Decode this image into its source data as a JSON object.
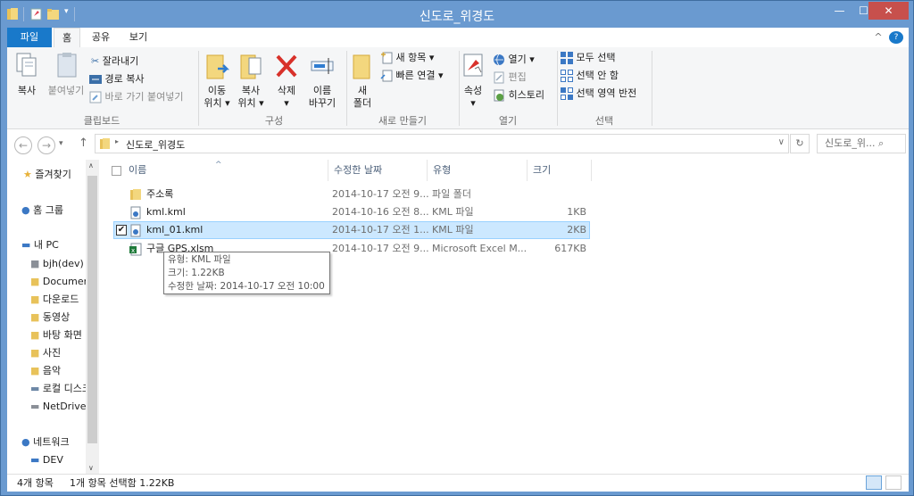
{
  "window": {
    "title": "신도로_위경도"
  },
  "window_buttons": {
    "minimize": "—",
    "maximize": "☐",
    "close": "✕"
  },
  "menu": {
    "file": "파일",
    "home": "홈",
    "share": "공유",
    "view": "보기",
    "expand": "^",
    "help": "?"
  },
  "ribbon": {
    "clipboard": {
      "copy": "복사",
      "paste": "붙여넣기",
      "cut": "잘라내기",
      "copy_path": "경로 복사",
      "paste_shortcut": "바로 가기 붙여넣기",
      "label": "클립보드"
    },
    "organize": {
      "move_line1": "이동",
      "move_line2": "위치 ▾",
      "copy_line1": "복사",
      "copy_line2": "위치 ▾",
      "delete": "삭제",
      "delete_arrow": "▾",
      "rename_line1": "이름",
      "rename_line2": "바꾸기",
      "label": "구성"
    },
    "new": {
      "folder_line1": "새",
      "folder_line2": "폴더",
      "new_item": "새 항목 ▾",
      "easy_access": "빠른 연결 ▾",
      "label": "새로 만들기"
    },
    "open": {
      "properties": "속성",
      "properties_arrow": "▾",
      "open": "열기 ▾",
      "edit": "편집",
      "history": "히스토리",
      "label": "열기"
    },
    "select": {
      "select_all": "모두 선택",
      "select_none": "선택 안 함",
      "invert": "선택 영역 반전",
      "label": "선택"
    }
  },
  "address": {
    "path": "신도로_위경도",
    "search_placeholder": "신도로_위... ⌕"
  },
  "nav": {
    "favorites": "즐겨찾기",
    "homegroup": "홈 그룹",
    "thispc": "내 PC",
    "items": [
      "bjh(dev)",
      "Documents",
      "다운로드",
      "동영상",
      "바탕 화면",
      "사진",
      "음악",
      "로컬 디스크",
      "NetDrive"
    ],
    "network": "네트워크",
    "dev": "DEV"
  },
  "columns": {
    "name": "이름",
    "date": "수정한 날짜",
    "type": "유형",
    "size": "크기"
  },
  "files": [
    {
      "name": "주소록",
      "date": "2014-10-17 오전 9...",
      "type": "파일 폴더",
      "size": "",
      "icon": "folder-icon"
    },
    {
      "name": "kml.kml",
      "date": "2014-10-16 오전 8...",
      "type": "KML 파일",
      "size": "1KB",
      "icon": "kml-icon"
    },
    {
      "name": "kml_01.kml",
      "date": "2014-10-17 오전 1...",
      "type": "KML 파일",
      "size": "2KB",
      "icon": "kml-icon"
    },
    {
      "name": "구글 GPS.xlsm",
      "date": "2014-10-17 오전 9...",
      "type": "Microsoft Excel M...",
      "size": "617KB",
      "icon": "excel-icon"
    }
  ],
  "tooltip": {
    "type": "유형: KML 파일",
    "size": "크기: 1.22KB",
    "date": "수정한 날짜: 2014-10-17 오전 10:00"
  },
  "status": {
    "count": "4개 항목",
    "selected": "1개 항목 선택함 1.22KB"
  },
  "colors": {
    "accent": "#1979ca",
    "titlebar": "#6a9ad0",
    "close": "#c7504c",
    "selection": "#cce8ff"
  }
}
